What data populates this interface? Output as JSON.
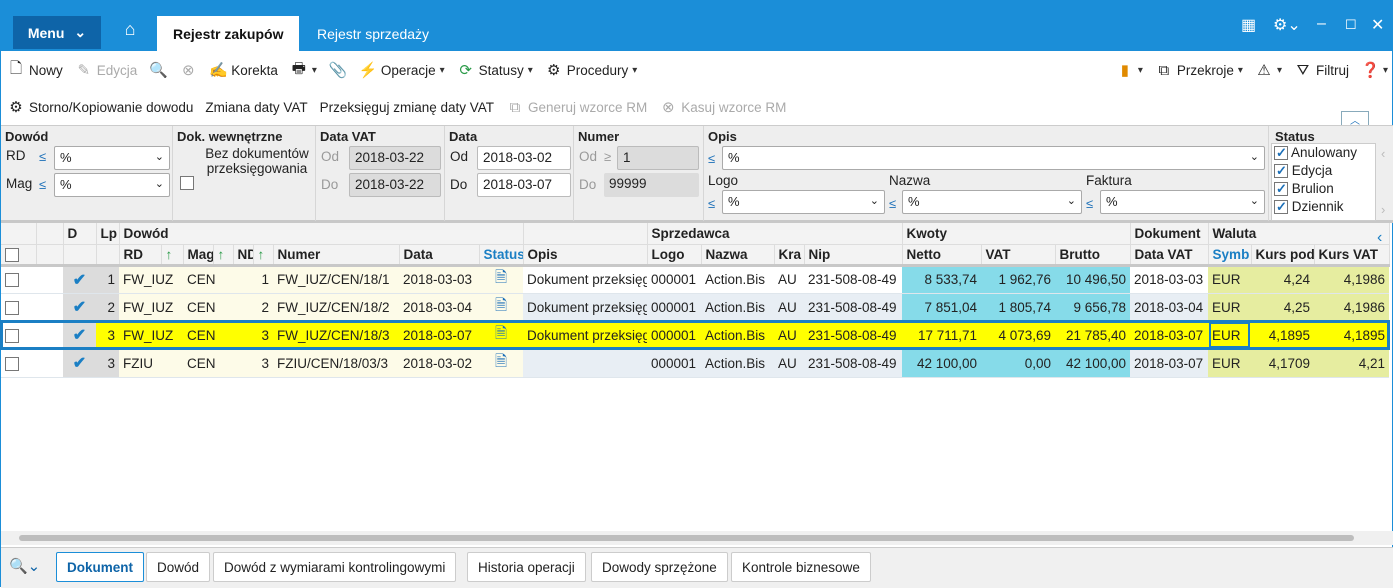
{
  "titlebar": {
    "menu": "Menu",
    "tabs": [
      {
        "label": "Rejestr zakupów",
        "active": true
      },
      {
        "label": "Rejestr sprzedaży",
        "active": false
      }
    ]
  },
  "toolbar1": {
    "new": "Nowy",
    "edit": "Edycja",
    "correction": "Korekta",
    "operations": "Operacje",
    "statuses": "Statusy",
    "procedures": "Procedury",
    "sections": "Przekroje",
    "filter": "Filtruj"
  },
  "toolbar2": {
    "storno": "Storno/Kopiowanie dowodu",
    "change_vat_date": "Zmiana daty VAT",
    "repost_vat_date": "Przeksięguj zmianę daty VAT",
    "generate_rm": "Generuj wzorce RM",
    "delete_rm": "Kasuj wzorce RM"
  },
  "filters": {
    "dowod": {
      "title": "Dowód",
      "rd_label": "RD",
      "rd_value": "%",
      "mag_label": "Mag",
      "mag_value": "%"
    },
    "internal": {
      "title": "Dok. wewnętrzne",
      "checkbox_label": "Bez dokumentów przeksięgowania",
      "checked": false
    },
    "data_vat": {
      "title": "Data VAT",
      "od_label": "Od",
      "od": "2018-03-22",
      "do_label": "Do",
      "do": "2018-03-22"
    },
    "data": {
      "title": "Data",
      "od_label": "Od",
      "od": "2018-03-02",
      "do_label": "Do",
      "do": "2018-03-07"
    },
    "numer": {
      "title": "Numer",
      "od_label": "Od",
      "od": "1",
      "do_label": "Do",
      "do": "99999"
    },
    "opis": {
      "title": "Opis",
      "value": "%",
      "logo_label": "Logo",
      "logo": "%",
      "nazwa_label": "Nazwa",
      "nazwa": "%",
      "faktura_label": "Faktura",
      "faktura": "%"
    },
    "status": {
      "title": "Status",
      "items": [
        {
          "label": "Anulowany",
          "checked": true
        },
        {
          "label": "Edycja",
          "checked": true
        },
        {
          "label": "Brulion",
          "checked": true
        },
        {
          "label": "Dziennik",
          "checked": true
        }
      ]
    }
  },
  "grid": {
    "groups": {
      "d": "D",
      "lp": "Lp",
      "dowod": "Dowód",
      "sprzedawca": "Sprzedawca",
      "kwoty": "Kwoty",
      "dokument": "Dokument",
      "waluta": "Waluta"
    },
    "columns": {
      "rd": "RD",
      "mag": "Mag",
      "nd": "ND",
      "numer": "Numer",
      "data": "Data",
      "status": "Status",
      "opis": "Opis",
      "logo": "Logo",
      "nazwa": "Nazwa",
      "kraj": "Kra",
      "nip": "Nip",
      "netto": "Netto",
      "vat": "VAT",
      "brutto": "Brutto",
      "data_vat": "Data VAT",
      "symb": "Symb",
      "kurs_pod": "Kurs pod.",
      "kurs_vat": "Kurs VAT"
    },
    "rows": [
      {
        "d": true,
        "lp": "1",
        "rd": "FW_IUZ",
        "mag": "CEN",
        "nd": "1",
        "numer": "FW_IUZ/CEN/18/1",
        "data": "2018-03-03",
        "opis": "Dokument przeksięgowania",
        "logo": "000001",
        "nazwa": "Action.Bis",
        "kraj": "AU",
        "nip": "231-508-08-49",
        "netto": "8 533,74",
        "vat": "1 962,76",
        "brutto": "10 496,50",
        "data_vat": "2018-03-03",
        "symb": "EUR",
        "kurs_pod": "4,24",
        "kurs_vat": "4,1986"
      },
      {
        "d": true,
        "lp": "2",
        "rd": "FW_IUZ",
        "mag": "CEN",
        "nd": "2",
        "numer": "FW_IUZ/CEN/18/2",
        "data": "2018-03-04",
        "opis": "Dokument przeksięgowania",
        "logo": "000001",
        "nazwa": "Action.Bis",
        "kraj": "AU",
        "nip": "231-508-08-49",
        "netto": "7 851,04",
        "vat": "1 805,74",
        "brutto": "9 656,78",
        "data_vat": "2018-03-04",
        "symb": "EUR",
        "kurs_pod": "4,25",
        "kurs_vat": "4,1986"
      },
      {
        "d": true,
        "lp": "3",
        "rd": "FW_IUZ",
        "mag": "CEN",
        "nd": "3",
        "numer": "FW_IUZ/CEN/18/3",
        "data": "2018-03-07",
        "opis": "Dokument przeksięgowania",
        "logo": "000001",
        "nazwa": "Action.Bis",
        "kraj": "AU",
        "nip": "231-508-08-49",
        "netto": "17 711,71",
        "vat": "4 073,69",
        "brutto": "21 785,40",
        "data_vat": "2018-03-07",
        "symb": "EUR",
        "kurs_pod": "4,1895",
        "kurs_vat": "4,1895",
        "selected": true
      },
      {
        "d": true,
        "lp": "3",
        "rd": "FZIU",
        "mag": "CEN",
        "nd": "3",
        "numer": "FZIU/CEN/18/03/3",
        "data": "2018-03-02",
        "opis": "",
        "logo": "000001",
        "nazwa": "Action.Bis",
        "kraj": "AU",
        "nip": "231-508-08-49",
        "netto": "42 100,00",
        "vat": "0,00",
        "brutto": "42 100,00",
        "data_vat": "2018-03-07",
        "symb": "EUR",
        "kurs_pod": "4,1709",
        "kurs_vat": "4,21"
      }
    ]
  },
  "bottom_tabs": [
    {
      "label": "Dokument",
      "active": true
    },
    {
      "label": "Dowód"
    },
    {
      "label": "Dowód z wymiarami kontrolingowymi"
    },
    {
      "label": "Historia operacji"
    },
    {
      "label": "Dowody sprzężone"
    },
    {
      "label": "Kontrole biznesowe"
    }
  ],
  "colors": {
    "accent": "#1b8ed8",
    "selected_row": "#ffff00",
    "amount_cell": "#86dbe9",
    "currency_cell": "#e6eda0"
  }
}
